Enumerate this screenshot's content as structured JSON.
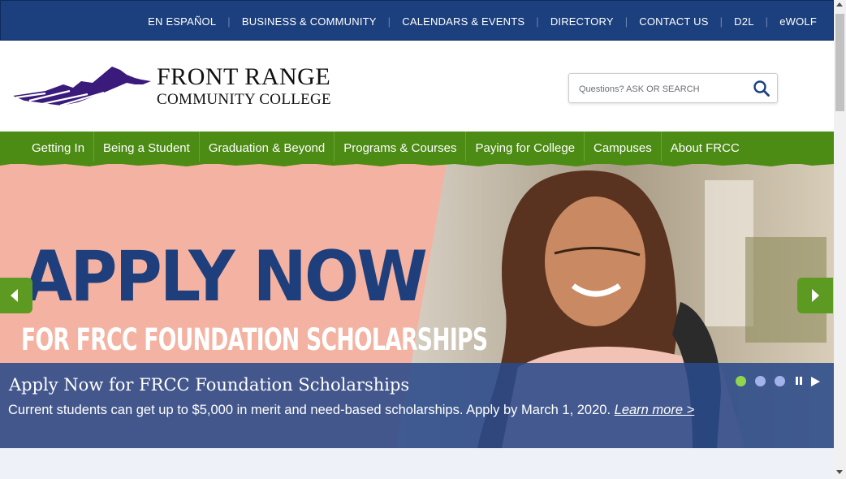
{
  "utility_nav": {
    "items": [
      {
        "label": "EN ESPAÑOL"
      },
      {
        "label": "BUSINESS & COMMUNITY"
      },
      {
        "label": "CALENDARS & EVENTS"
      },
      {
        "label": "DIRECTORY"
      },
      {
        "label": "CONTACT US"
      },
      {
        "label": "D2L"
      },
      {
        "label": "eWOLF"
      }
    ]
  },
  "header": {
    "logo_line1": "FRONT RANGE",
    "logo_line2": "COMMUNITY COLLEGE",
    "search_placeholder": "Questions? ASK OR SEARCH",
    "search_icon": "search-icon"
  },
  "main_nav": {
    "items": [
      {
        "label": "Getting In"
      },
      {
        "label": "Being a Student"
      },
      {
        "label": "Graduation & Beyond"
      },
      {
        "label": "Programs & Courses"
      },
      {
        "label": "Paying for College"
      },
      {
        "label": "Campuses"
      },
      {
        "label": "About FRCC"
      }
    ]
  },
  "hero": {
    "headline": "APPLY NOW",
    "subheadline": "FOR FRCC FOUNDATION SCHOLARSHIPS",
    "caption_title": "Apply Now for FRCC Foundation Scholarships",
    "caption_text": "Current students can get up to $5,000 in merit and need-based scholarships. Apply by March 1, 2020.",
    "caption_link": "Learn more >",
    "slides_total": 3,
    "active_slide": 1,
    "prev_icon": "chevron-left-icon",
    "next_icon": "chevron-right-icon"
  },
  "colors": {
    "utility_bar": "#1c3f7d",
    "nav_green": "#4c8b14",
    "hero_pink": "#f4b3a2",
    "brand_navy": "#1f3f7c",
    "logo_purple": "#3a1a7a",
    "dot_active": "#8fd54e"
  }
}
